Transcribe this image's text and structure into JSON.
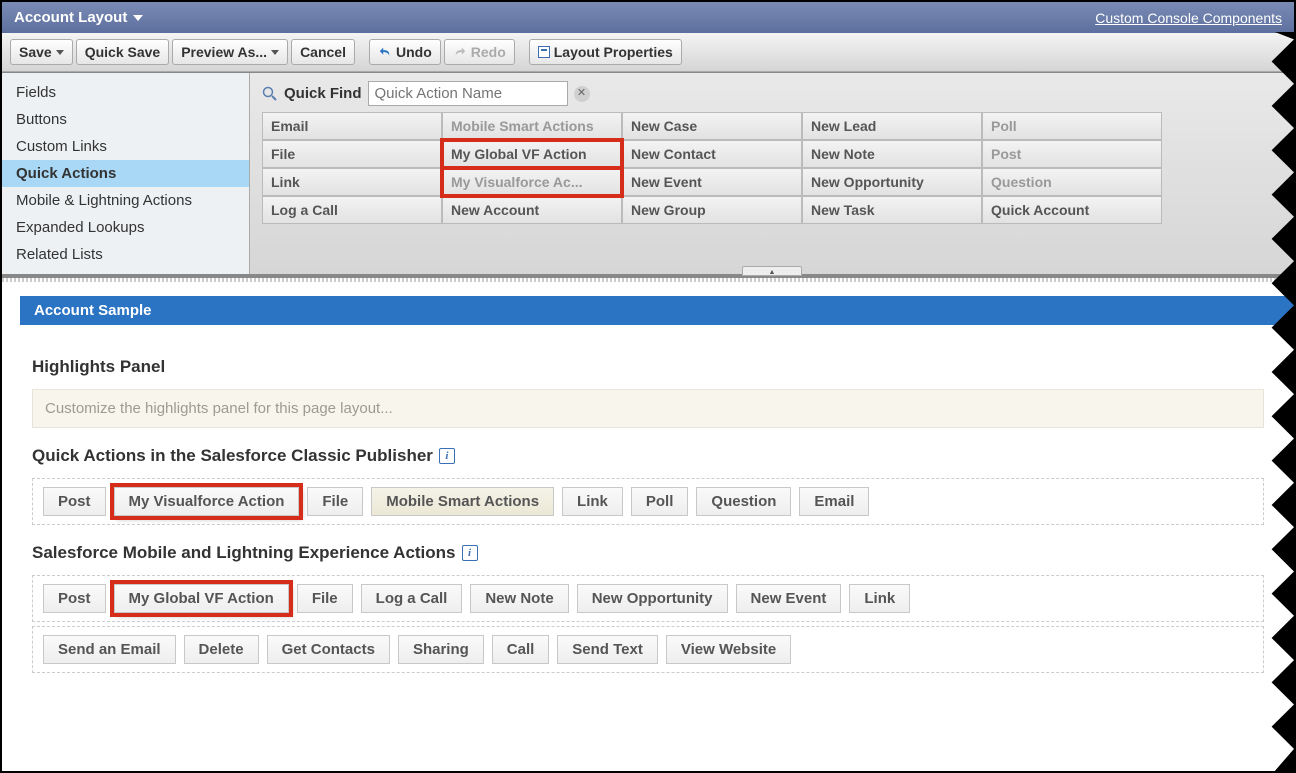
{
  "header": {
    "title": "Account Layout",
    "componentsLink": "Custom Console Components"
  },
  "toolbar": {
    "save": "Save",
    "quicksave": "Quick Save",
    "previewAs": "Preview As...",
    "cancel": "Cancel",
    "undo": "Undo",
    "redo": "Redo",
    "layoutProps": "Layout Properties"
  },
  "sidebar": {
    "items": [
      {
        "label": "Fields"
      },
      {
        "label": "Buttons"
      },
      {
        "label": "Custom Links"
      },
      {
        "label": "Quick Actions",
        "active": true
      },
      {
        "label": "Mobile & Lightning Actions"
      },
      {
        "label": "Expanded Lookups"
      },
      {
        "label": "Related Lists"
      }
    ]
  },
  "quickfind": {
    "label": "Quick Find",
    "placeholder": "Quick Action Name"
  },
  "grid": {
    "cols": [
      [
        "Email",
        "File",
        "Link",
        "Log a Call"
      ],
      [
        "Mobile Smart Actions",
        "My Global VF Action",
        "My Visualforce Ac...",
        "New Account"
      ],
      [
        "New Case",
        "New Contact",
        "New Event",
        "New Group"
      ],
      [
        "New Lead",
        "New Note",
        "New Opportunity",
        "New Task"
      ],
      [
        "Poll",
        "Post",
        "Question",
        "Quick Account"
      ]
    ],
    "dimCells": [
      "Mobile Smart Actions",
      "My Visualforce Ac...",
      "Poll",
      "Post",
      "Question"
    ],
    "highlight": [
      "My Global VF Action",
      "My Visualforce Ac..."
    ]
  },
  "canvas": {
    "sectionTitle": "Account Sample",
    "highlights": {
      "title": "Highlights Panel",
      "placeholder": "Customize the highlights panel for this page layout..."
    },
    "classic": {
      "title": "Quick Actions in the Salesforce Classic Publisher",
      "items": [
        {
          "label": "Post"
        },
        {
          "label": "My Visualforce Action",
          "hl": true
        },
        {
          "label": "File"
        },
        {
          "label": "Mobile Smart Actions",
          "msa": true
        },
        {
          "label": "Link"
        },
        {
          "label": "Poll"
        },
        {
          "label": "Question"
        },
        {
          "label": "Email"
        }
      ]
    },
    "lex": {
      "title": "Salesforce Mobile and Lightning Experience Actions",
      "row1": [
        {
          "label": "Post"
        },
        {
          "label": "My Global VF Action",
          "hl": true
        },
        {
          "label": "File"
        },
        {
          "label": "Log a Call"
        },
        {
          "label": "New Note"
        },
        {
          "label": "New Opportunity"
        },
        {
          "label": "New Event"
        },
        {
          "label": "Link"
        }
      ],
      "row2": [
        {
          "label": "Send an Email"
        },
        {
          "label": "Delete"
        },
        {
          "label": "Get Contacts"
        },
        {
          "label": "Sharing"
        },
        {
          "label": "Call"
        },
        {
          "label": "Send Text"
        },
        {
          "label": "View Website"
        }
      ]
    }
  }
}
